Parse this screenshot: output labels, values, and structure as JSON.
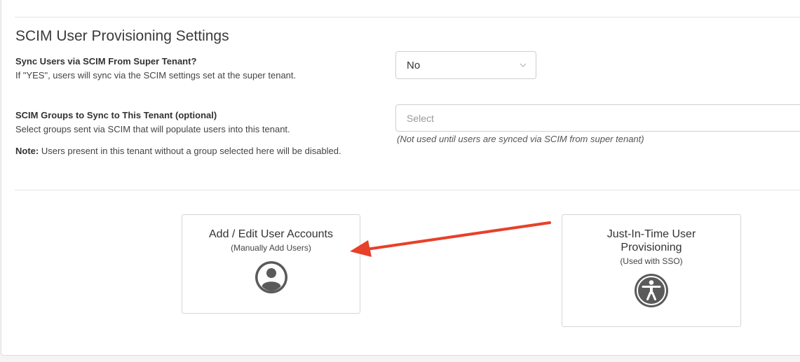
{
  "section": {
    "title": "SCIM User Provisioning Settings"
  },
  "sync_users": {
    "label": "Sync Users via SCIM From Super Tenant?",
    "help": "If \"YES\", users will sync via the SCIM settings set at the super tenant.",
    "value": "No"
  },
  "scim_groups": {
    "label": "SCIM Groups to Sync to This Tenant (optional)",
    "help": "Select groups sent via SCIM that will populate users into this tenant.",
    "note_prefix": "Note:",
    "note_text": " Users present in this tenant without a group selected here will be disabled.",
    "placeholder": "Select",
    "hint": "(Not used until users are synced via SCIM from super tenant)"
  },
  "cards": {
    "add_users": {
      "title": "Add / Edit User Accounts",
      "subtitle": "(Manually Add Users)",
      "icon": "user-circle-icon"
    },
    "jit": {
      "title": "Just-In-Time User Provisioning",
      "subtitle": "(Used with SSO)",
      "icon": "accessibility-icon"
    }
  },
  "colors": {
    "arrow": "#e8402a",
    "icon": "#5a5a5a"
  }
}
